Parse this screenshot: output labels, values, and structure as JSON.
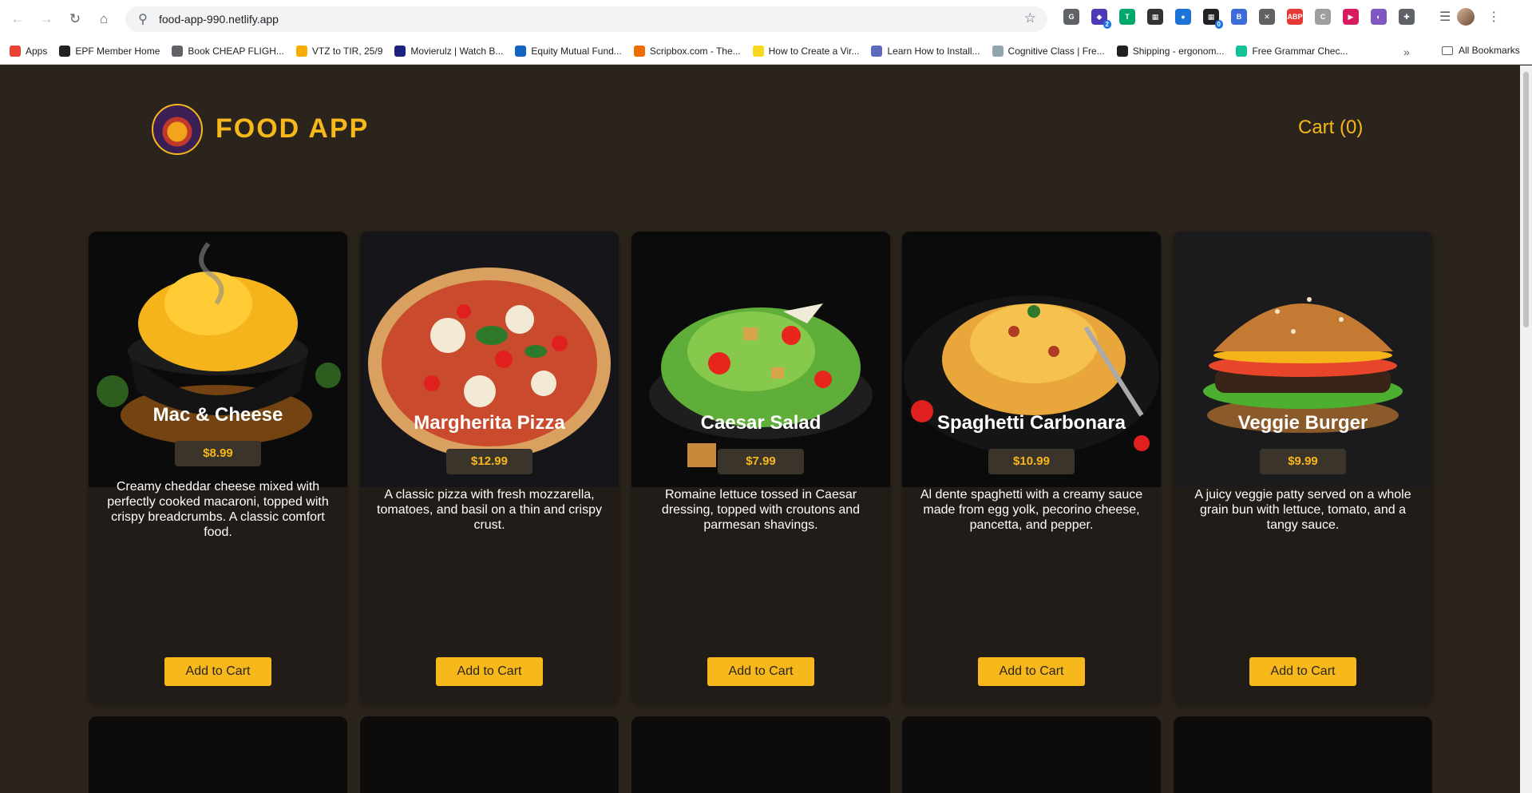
{
  "browser": {
    "url": "food-app-990.netlify.app",
    "bookmarks": [
      {
        "label": "Apps",
        "color": "#ea4335"
      },
      {
        "label": "EPF Member Home",
        "color": "#202124"
      },
      {
        "label": "Book CHEAP FLIGH...",
        "color": "#5f6368"
      },
      {
        "label": "VTZ to TIR, 25/9",
        "color": "#f9ab00"
      },
      {
        "label": "Movierulz | Watch B...",
        "color": "#1a237e"
      },
      {
        "label": "Equity Mutual Fund...",
        "color": "#1565c0"
      },
      {
        "label": "Scripbox.com - The...",
        "color": "#ef6c00"
      },
      {
        "label": "How to Create a Vir...",
        "color": "#f9d71c"
      },
      {
        "label": "Learn How to Install...",
        "color": "#5c6bc0"
      },
      {
        "label": "Cognitive Class | Fre...",
        "color": "#90a4ae"
      },
      {
        "label": "Shipping - ergonom...",
        "color": "#202124"
      },
      {
        "label": "Free Grammar Chec...",
        "color": "#15c39a"
      }
    ],
    "all_bookmarks_label": "All Bookmarks",
    "extensions": [
      {
        "icon": "grammarly-icon",
        "color": "#5f6368",
        "glyph": "G",
        "badge": ""
      },
      {
        "icon": "extension-purple-icon",
        "color": "#4a3ab5",
        "glyph": "◆",
        "badge": "2"
      },
      {
        "icon": "t-extension-icon",
        "color": "#00a86b",
        "glyph": "T",
        "badge": ""
      },
      {
        "icon": "dark-extension-icon",
        "color": "#333333",
        "glyph": "▦",
        "badge": ""
      },
      {
        "icon": "blue-circle-extension-icon",
        "color": "#1e73d8",
        "glyph": "●",
        "badge": ""
      },
      {
        "icon": "grid-extension-icon",
        "color": "#202124",
        "glyph": "▦",
        "badge": "0"
      },
      {
        "icon": "b-extension-icon",
        "color": "#3f6bd8",
        "glyph": "B",
        "badge": ""
      },
      {
        "icon": "x-extension-icon",
        "color": "#616161",
        "glyph": "✕",
        "badge": ""
      },
      {
        "icon": "adblock-icon",
        "color": "#e53935",
        "glyph": "ABP",
        "badge": ""
      },
      {
        "icon": "c-extension-icon",
        "color": "#9e9e9e",
        "glyph": "C",
        "badge": ""
      },
      {
        "icon": "play-extension-icon",
        "color": "#d81b60",
        "glyph": "▶",
        "badge": ""
      },
      {
        "icon": "color-extension-icon",
        "color": "#7e57c2",
        "glyph": "◐",
        "badge": ""
      },
      {
        "icon": "puzzle-icon",
        "color": "#5f6368",
        "glyph": "✚",
        "badge": ""
      }
    ]
  },
  "header": {
    "brand": "FOOD APP",
    "cart_label": "Cart (0)"
  },
  "accent": "#f6b81a",
  "menu": [
    {
      "title": "Mac & Cheese",
      "price": "$8.99",
      "description": "Creamy cheddar cheese mixed with perfectly cooked macaroni, topped with crispy breadcrumbs. A classic comfort food.",
      "button": "Add to Cart",
      "image": "mac-and-cheese-image"
    },
    {
      "title": "Margherita Pizza",
      "price": "$12.99",
      "description": "A classic pizza with fresh mozzarella, tomatoes, and basil on a thin and crispy crust.",
      "button": "Add to Cart",
      "image": "margherita-pizza-image"
    },
    {
      "title": "Caesar Salad",
      "price": "$7.99",
      "description": "Romaine lettuce tossed in Caesar dressing, topped with croutons and parmesan shavings.",
      "button": "Add to Cart",
      "image": "caesar-salad-image"
    },
    {
      "title": "Spaghetti Carbonara",
      "price": "$10.99",
      "description": "Al dente spaghetti with a creamy sauce made from egg yolk, pecorino cheese, pancetta, and pepper.",
      "button": "Add to Cart",
      "image": "spaghetti-carbonara-image"
    },
    {
      "title": "Veggie Burger",
      "price": "$9.99",
      "description": "A juicy veggie patty served on a whole grain bun with lettuce, tomato, and a tangy sauce.",
      "button": "Add to Cart",
      "image": "veggie-burger-image"
    }
  ]
}
